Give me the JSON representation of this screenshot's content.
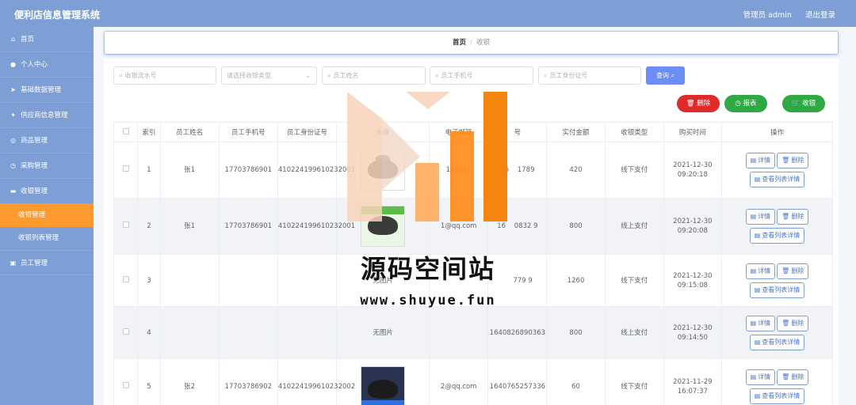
{
  "header": {
    "app_title": "便利店信息管理系统",
    "user_label": "管理员 admin",
    "logout_label": "退出登录"
  },
  "sidebar": {
    "items": [
      {
        "label": "首页",
        "icon": "home-icon"
      },
      {
        "label": "个人中心",
        "icon": "user-icon"
      },
      {
        "label": "基础数据管理",
        "icon": "send-icon"
      },
      {
        "label": "供应商信息管理",
        "icon": "bulb-icon"
      },
      {
        "label": "商品管理",
        "icon": "goods-icon"
      },
      {
        "label": "采购管理",
        "icon": "clock-icon"
      },
      {
        "label": "收银管理",
        "icon": "cashier-icon"
      }
    ],
    "subitems": [
      {
        "label": "收银管理",
        "active": true
      },
      {
        "label": "收银列表管理",
        "active": false
      }
    ],
    "last_item": {
      "label": "员工管理",
      "icon": "staff-icon"
    }
  },
  "breadcrumb": {
    "home": "首页",
    "separator": "/",
    "current": "收银"
  },
  "search": {
    "order_placeholder": "收银流水号",
    "type_placeholder": "请选择收银类型",
    "name_placeholder": "员工姓名",
    "phone_placeholder": "员工手机号",
    "idcard_placeholder": "员工身份证号",
    "query_label": "查询"
  },
  "actions": {
    "delete_label": "删除",
    "report_label": "报表",
    "checkout_label": "收银"
  },
  "table": {
    "headers": [
      "索引",
      "员工姓名",
      "员工手机号",
      "员工身份证号",
      "头像",
      "电子邮箱",
      "号",
      "实付金额",
      "收银类型",
      "购买时间",
      "操作"
    ],
    "rows": [
      {
        "index": "1",
        "name": "张1",
        "phone": "17703786901",
        "idcard": "410224199610232001",
        "image": "pot",
        "email": "1@qq.c",
        "serial": "16    1789",
        "amount": "420",
        "type": "线下支付",
        "time": "2021-12-30 09:20:18"
      },
      {
        "index": "2",
        "name": "张1",
        "phone": "17703786901",
        "idcard": "410224199610232001",
        "image": "green",
        "email": "1@qq.com",
        "serial": "16    0832 9",
        "amount": "800",
        "type": "线上支付",
        "time": "2021-12-30 09:20:08"
      },
      {
        "index": "3",
        "name": "",
        "phone": "",
        "idcard": "",
        "image": "无图片",
        "email": "",
        "serial": "     779 9",
        "amount": "1260",
        "type": "线下支付",
        "time": "2021-12-30 09:15:08"
      },
      {
        "index": "4",
        "name": "",
        "phone": "",
        "idcard": "",
        "image": "无图片",
        "email": "",
        "serial": "1640826890363",
        "amount": "800",
        "type": "线上支付",
        "time": "2021-12-30 09:14:50"
      },
      {
        "index": "5",
        "name": "张2",
        "phone": "17703786902",
        "idcard": "410224199610232002",
        "image": "dark",
        "email": "2@qq.com",
        "serial": "1640765257336",
        "amount": "60",
        "type": "线下支付",
        "time": "2021-11-29 16:07:37"
      }
    ],
    "op_detail": "详情",
    "op_delete": "删除",
    "op_list_detail": "查看列表详情"
  },
  "watermark": {
    "title": "源码空间站",
    "url": "www.shuyue.fun",
    "colors": [
      "#f8d2b8",
      "#ffab5c",
      "#ff8c1a",
      "#f57e00"
    ]
  },
  "colors": {
    "primary": "#7e9fd6",
    "active": "#ff9a2e",
    "danger": "#e02b2b",
    "success": "#2fa943",
    "query": "#6c8df5"
  }
}
